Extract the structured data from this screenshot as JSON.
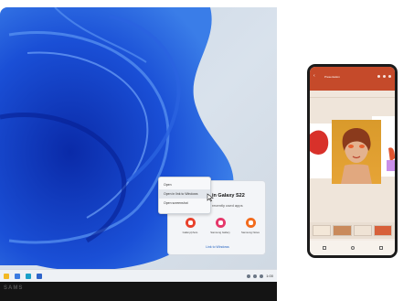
{
  "context_menu": {
    "items": [
      "Open",
      "Open in link to Windows",
      "Open screenshot"
    ]
  },
  "flyout": {
    "title": "in Galaxy S22",
    "subtitle": "recently used apps",
    "apps": [
      {
        "label": "Gallery/photo",
        "color": "#e8412c",
        "icon": "app-icon"
      },
      {
        "label": "Samsung Gallery",
        "color": "#e5386b",
        "icon": "app-icon"
      },
      {
        "label": "Samsung Notes",
        "color": "#f26b1d",
        "icon": "app-icon"
      }
    ],
    "link_text": "Link to Windows"
  },
  "taskbar": {
    "time": "1:00",
    "date": "7/7/22"
  },
  "watermark": "SAMS",
  "phone": {
    "app_title": "Presentation"
  }
}
